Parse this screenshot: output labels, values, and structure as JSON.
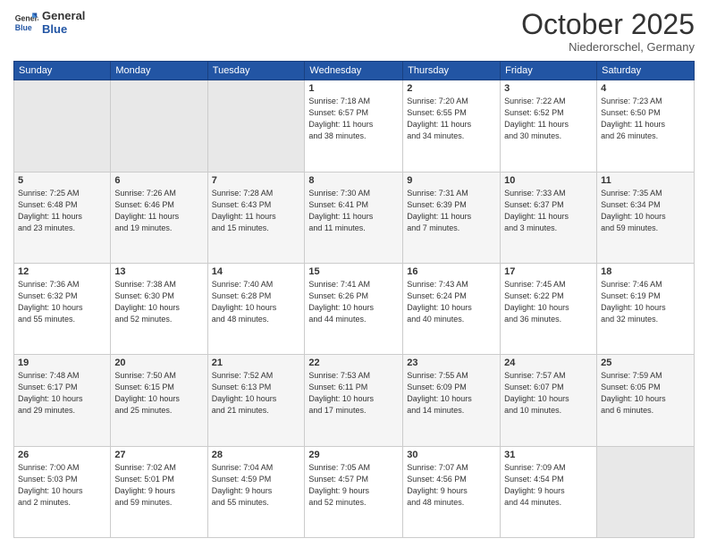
{
  "header": {
    "logo_line1": "General",
    "logo_line2": "Blue",
    "month": "October 2025",
    "location": "Niederorschel, Germany"
  },
  "weekdays": [
    "Sunday",
    "Monday",
    "Tuesday",
    "Wednesday",
    "Thursday",
    "Friday",
    "Saturday"
  ],
  "weeks": [
    [
      {
        "day": "",
        "info": ""
      },
      {
        "day": "",
        "info": ""
      },
      {
        "day": "",
        "info": ""
      },
      {
        "day": "1",
        "info": "Sunrise: 7:18 AM\nSunset: 6:57 PM\nDaylight: 11 hours\nand 38 minutes."
      },
      {
        "day": "2",
        "info": "Sunrise: 7:20 AM\nSunset: 6:55 PM\nDaylight: 11 hours\nand 34 minutes."
      },
      {
        "day": "3",
        "info": "Sunrise: 7:22 AM\nSunset: 6:52 PM\nDaylight: 11 hours\nand 30 minutes."
      },
      {
        "day": "4",
        "info": "Sunrise: 7:23 AM\nSunset: 6:50 PM\nDaylight: 11 hours\nand 26 minutes."
      }
    ],
    [
      {
        "day": "5",
        "info": "Sunrise: 7:25 AM\nSunset: 6:48 PM\nDaylight: 11 hours\nand 23 minutes."
      },
      {
        "day": "6",
        "info": "Sunrise: 7:26 AM\nSunset: 6:46 PM\nDaylight: 11 hours\nand 19 minutes."
      },
      {
        "day": "7",
        "info": "Sunrise: 7:28 AM\nSunset: 6:43 PM\nDaylight: 11 hours\nand 15 minutes."
      },
      {
        "day": "8",
        "info": "Sunrise: 7:30 AM\nSunset: 6:41 PM\nDaylight: 11 hours\nand 11 minutes."
      },
      {
        "day": "9",
        "info": "Sunrise: 7:31 AM\nSunset: 6:39 PM\nDaylight: 11 hours\nand 7 minutes."
      },
      {
        "day": "10",
        "info": "Sunrise: 7:33 AM\nSunset: 6:37 PM\nDaylight: 11 hours\nand 3 minutes."
      },
      {
        "day": "11",
        "info": "Sunrise: 7:35 AM\nSunset: 6:34 PM\nDaylight: 10 hours\nand 59 minutes."
      }
    ],
    [
      {
        "day": "12",
        "info": "Sunrise: 7:36 AM\nSunset: 6:32 PM\nDaylight: 10 hours\nand 55 minutes."
      },
      {
        "day": "13",
        "info": "Sunrise: 7:38 AM\nSunset: 6:30 PM\nDaylight: 10 hours\nand 52 minutes."
      },
      {
        "day": "14",
        "info": "Sunrise: 7:40 AM\nSunset: 6:28 PM\nDaylight: 10 hours\nand 48 minutes."
      },
      {
        "day": "15",
        "info": "Sunrise: 7:41 AM\nSunset: 6:26 PM\nDaylight: 10 hours\nand 44 minutes."
      },
      {
        "day": "16",
        "info": "Sunrise: 7:43 AM\nSunset: 6:24 PM\nDaylight: 10 hours\nand 40 minutes."
      },
      {
        "day": "17",
        "info": "Sunrise: 7:45 AM\nSunset: 6:22 PM\nDaylight: 10 hours\nand 36 minutes."
      },
      {
        "day": "18",
        "info": "Sunrise: 7:46 AM\nSunset: 6:19 PM\nDaylight: 10 hours\nand 32 minutes."
      }
    ],
    [
      {
        "day": "19",
        "info": "Sunrise: 7:48 AM\nSunset: 6:17 PM\nDaylight: 10 hours\nand 29 minutes."
      },
      {
        "day": "20",
        "info": "Sunrise: 7:50 AM\nSunset: 6:15 PM\nDaylight: 10 hours\nand 25 minutes."
      },
      {
        "day": "21",
        "info": "Sunrise: 7:52 AM\nSunset: 6:13 PM\nDaylight: 10 hours\nand 21 minutes."
      },
      {
        "day": "22",
        "info": "Sunrise: 7:53 AM\nSunset: 6:11 PM\nDaylight: 10 hours\nand 17 minutes."
      },
      {
        "day": "23",
        "info": "Sunrise: 7:55 AM\nSunset: 6:09 PM\nDaylight: 10 hours\nand 14 minutes."
      },
      {
        "day": "24",
        "info": "Sunrise: 7:57 AM\nSunset: 6:07 PM\nDaylight: 10 hours\nand 10 minutes."
      },
      {
        "day": "25",
        "info": "Sunrise: 7:59 AM\nSunset: 6:05 PM\nDaylight: 10 hours\nand 6 minutes."
      }
    ],
    [
      {
        "day": "26",
        "info": "Sunrise: 7:00 AM\nSunset: 5:03 PM\nDaylight: 10 hours\nand 2 minutes."
      },
      {
        "day": "27",
        "info": "Sunrise: 7:02 AM\nSunset: 5:01 PM\nDaylight: 9 hours\nand 59 minutes."
      },
      {
        "day": "28",
        "info": "Sunrise: 7:04 AM\nSunset: 4:59 PM\nDaylight: 9 hours\nand 55 minutes."
      },
      {
        "day": "29",
        "info": "Sunrise: 7:05 AM\nSunset: 4:57 PM\nDaylight: 9 hours\nand 52 minutes."
      },
      {
        "day": "30",
        "info": "Sunrise: 7:07 AM\nSunset: 4:56 PM\nDaylight: 9 hours\nand 48 minutes."
      },
      {
        "day": "31",
        "info": "Sunrise: 7:09 AM\nSunset: 4:54 PM\nDaylight: 9 hours\nand 44 minutes."
      },
      {
        "day": "",
        "info": ""
      }
    ]
  ]
}
